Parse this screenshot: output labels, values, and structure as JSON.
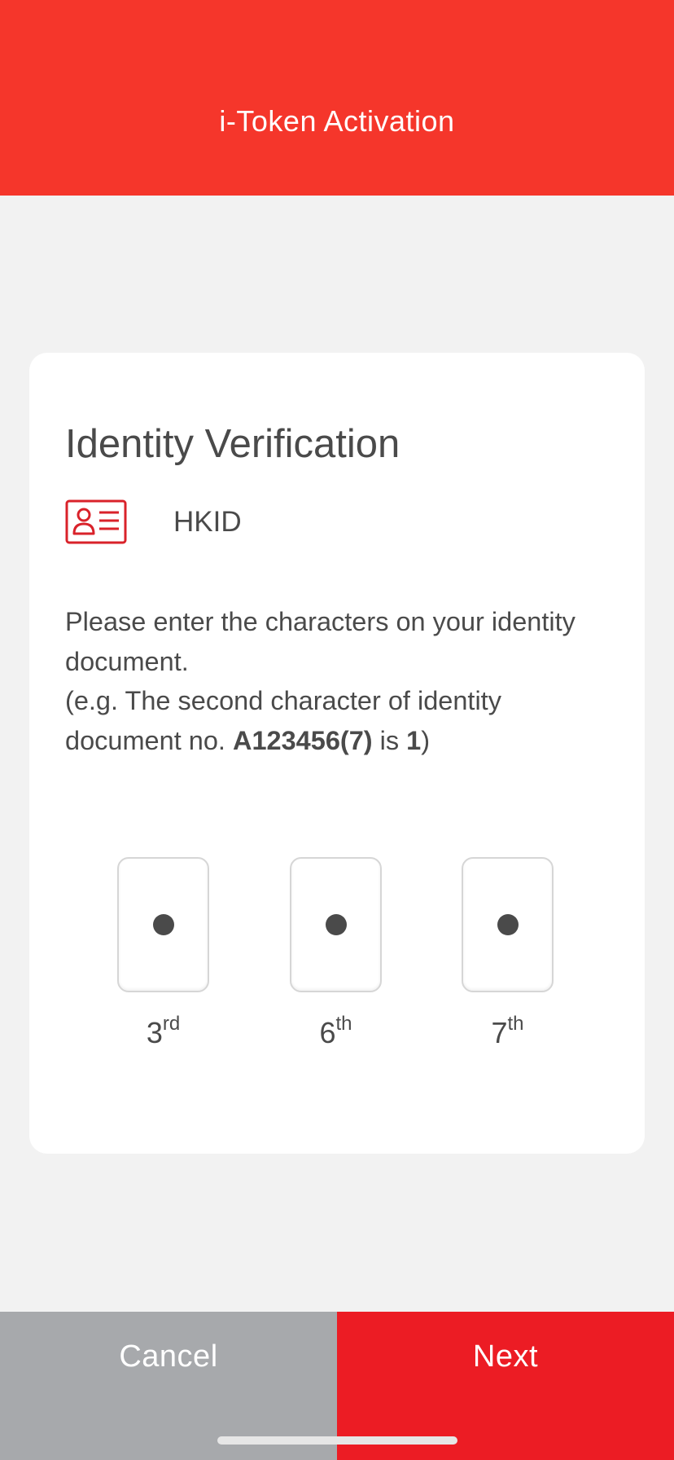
{
  "header": {
    "title": "i-Token Activation"
  },
  "card": {
    "title": "Identity Verification",
    "document_type": {
      "icon": "id-card-icon",
      "label": "HKID"
    },
    "instructions": {
      "line1": "Please enter the characters on your identity document.",
      "example_prefix": "(e.g. The second character of identity document no.",
      "example_doc": "A123456(7)",
      "example_is": "is",
      "example_char": "1",
      "example_suffix": ")"
    },
    "character_inputs": [
      {
        "position": "3",
        "suffix": "rd",
        "value": "•"
      },
      {
        "position": "6",
        "suffix": "th",
        "value": "•"
      },
      {
        "position": "7",
        "suffix": "th",
        "value": "•"
      }
    ]
  },
  "footer": {
    "cancel_label": "Cancel",
    "next_label": "Next"
  },
  "colors": {
    "header_red": "#f5362b",
    "next_red": "#ec1c24",
    "cancel_grey": "#a7a9ac",
    "icon_red": "#d9222a",
    "text_dark": "#4a4a4a"
  }
}
